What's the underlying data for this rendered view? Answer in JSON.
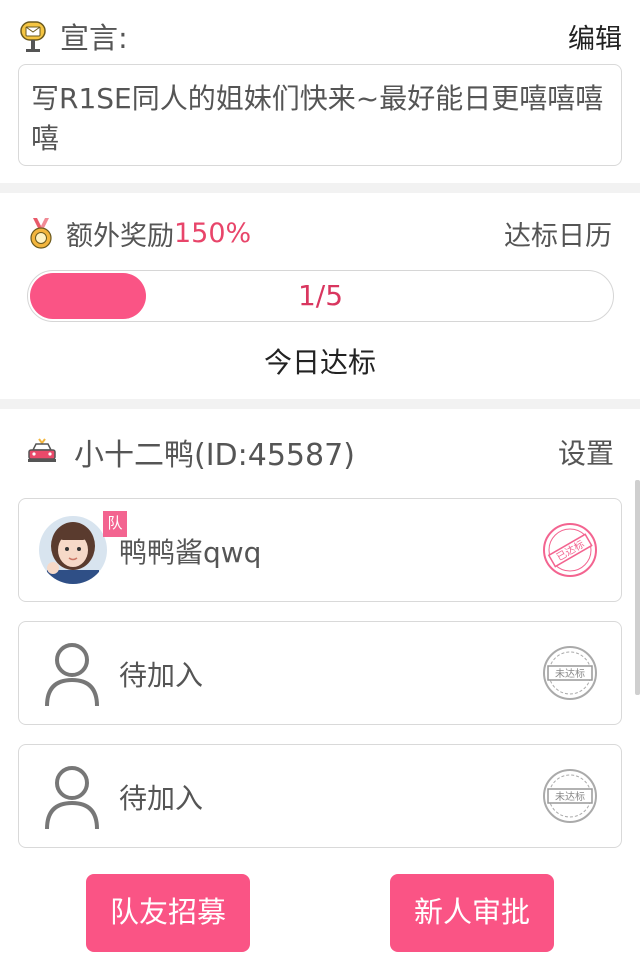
{
  "manifesto": {
    "title": "宣言:",
    "edit_label": "编辑",
    "text": "写R1SE同人的姐妹们快来~最好能日更嘻嘻嘻嘻"
  },
  "bonus": {
    "label": "额外奖励",
    "value": "150%",
    "calendar_label": "达标日历",
    "progress_text": "1/5",
    "progress_fraction": 0.2,
    "today_label": "今日达标"
  },
  "team": {
    "name": "小十二鸭(ID:45587)",
    "settings_label": "设置",
    "members": [
      {
        "name": "鸭鸭酱qwq",
        "badge": "队",
        "stamp": "已达标",
        "is_leader": true
      },
      {
        "name": "待加入",
        "stamp": "未达标"
      },
      {
        "name": "待加入",
        "stamp": "未达标"
      }
    ]
  },
  "actions": {
    "recruit_label": "队友招募",
    "approve_label": "新人审批"
  },
  "colors": {
    "accent": "#fa5485",
    "accent_text": "#e8456a"
  },
  "icons": {
    "manifesto": "mailbox-icon",
    "bonus": "medal-icon",
    "team": "car-icon",
    "placeholder": "person-icon"
  }
}
